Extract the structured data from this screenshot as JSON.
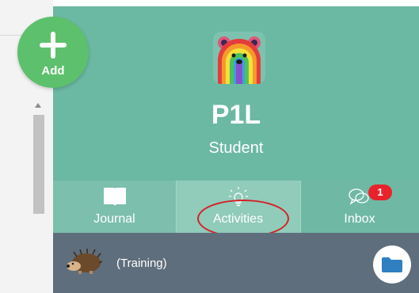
{
  "profile": {
    "name": "P1L",
    "role": "Student"
  },
  "add_button": {
    "label": "Add",
    "icon": "plus-icon"
  },
  "tabs": [
    {
      "label": "Journal",
      "icon": "book-icon"
    },
    {
      "label": "Activities",
      "icon": "lightbulb-icon"
    },
    {
      "label": "Inbox",
      "icon": "chat-bubbles-icon",
      "badge": "1"
    }
  ],
  "item_bar": {
    "label": "(Training)",
    "icon": "hedgehog-icon",
    "action_icon": "folder-icon"
  },
  "colors": {
    "profile_bg": "#6bb8a3",
    "add_button": "#5dc06c",
    "item_bar": "#5f6e7c",
    "badge": "#e8232b",
    "highlight": "#d42026"
  }
}
